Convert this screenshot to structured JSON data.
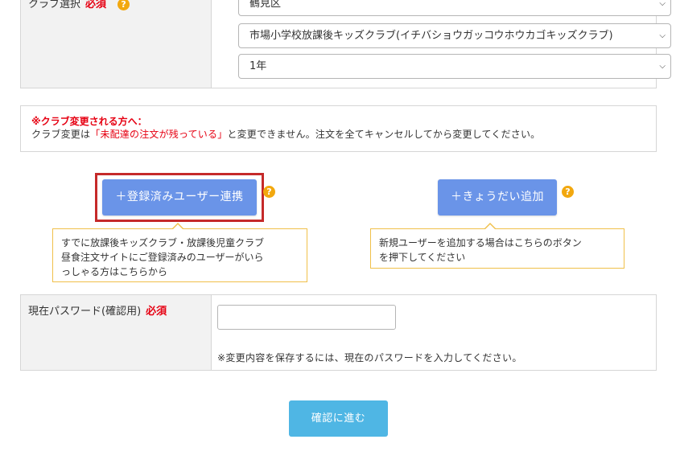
{
  "club_select": {
    "label": "クラブ選択",
    "required": "必須",
    "help_icon": "?",
    "ward_value": "鶴見区",
    "club_value": "市場小学校放課後キッズクラブ(イチバショウガッコウホウカゴキッズクラブ)",
    "grade_value": "1年"
  },
  "notice": {
    "title": "※クラブ変更される方へ：",
    "body_prefix": "クラブ変更は",
    "body_highlight": "「未配達の注文が残っている」",
    "body_suffix": "と変更できません。注文を全てキャンセルしてから変更してください。"
  },
  "actions": {
    "link_user_label": "＋登録済みユーザー連携",
    "link_user_tip_line1": "すでに放課後キッズクラブ・放課後児童クラブ",
    "link_user_tip_line2": "昼食注文サイトにご登録済みのユーザーがいら",
    "link_user_tip_line3": "っしゃる方はこちらから",
    "add_sibling_label": "＋きょうだい追加",
    "add_sibling_tip_line1": "新規ユーザーを追加する場合はこちらのボタン",
    "add_sibling_tip_line2": "を押下してください"
  },
  "password": {
    "label": "現在パスワード(確認用)",
    "required": "必須",
    "note": "※変更内容を保存するには、現在のパスワードを入力してください。"
  },
  "confirm_button": "確認に進む",
  "colors": {
    "required_red": "#e60012",
    "button_blue": "#6a94e8",
    "confirm_blue": "#4fb6e4",
    "help_orange": "#f2a80f",
    "tip_border": "#f0c04a",
    "focus_frame": "#c52a2a"
  }
}
